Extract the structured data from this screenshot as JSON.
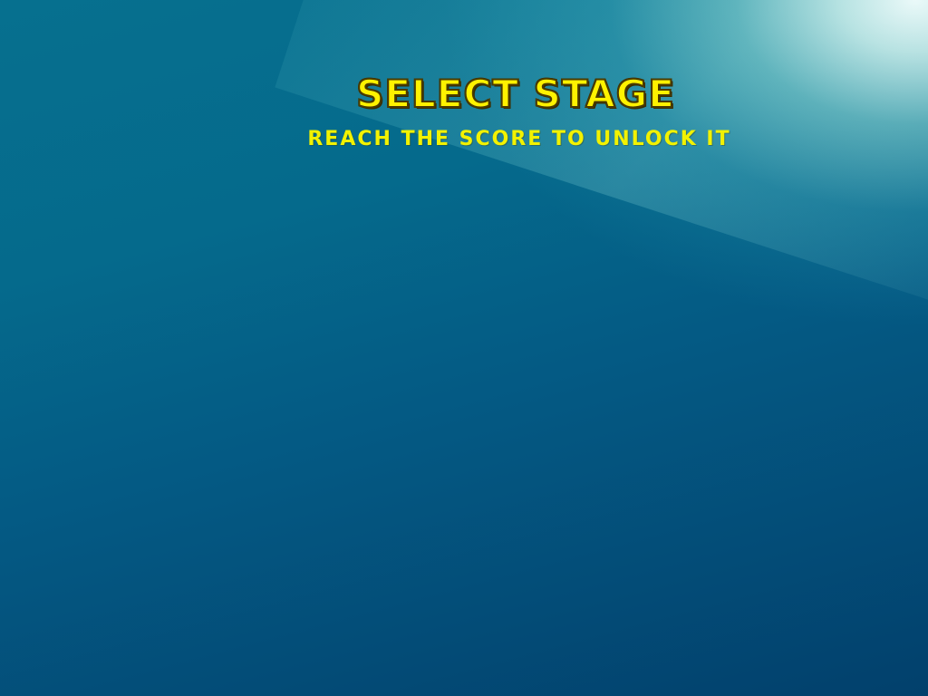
{
  "screen": {
    "title": "SELECT STAGE",
    "subtitle": "REACH THE SCORE TO UNLOCK IT"
  },
  "colors": {
    "title_fill": "#fff200",
    "title_outline": "#3a2c00",
    "subtitle": "#f2f200",
    "background_top": "#06708f",
    "background_bottom": "#02406c",
    "light_glow": "#ffffff"
  }
}
